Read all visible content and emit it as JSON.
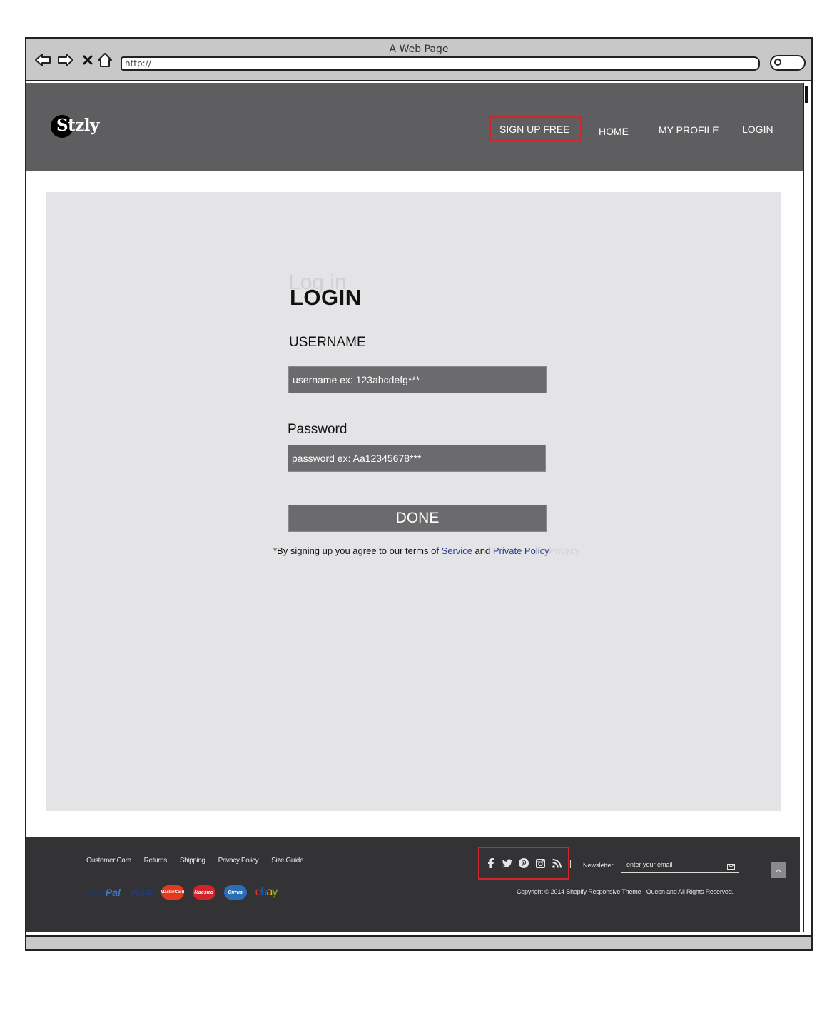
{
  "browser": {
    "title": "A Web Page",
    "url": "http://"
  },
  "header": {
    "logo": "Stzly",
    "nav": {
      "signup": "SIGN UP FREE",
      "home": "HOME",
      "profile": "MY PROFILE",
      "login": "LOGIN"
    },
    "highlight_color": "#d0262b"
  },
  "form": {
    "ghost_title": "Log in",
    "title": "LOGIN",
    "username_label": "USERNAME",
    "username_placeholder": "username ex: 123abcdefg***",
    "password_label": "Password",
    "password_placeholder": "password ex: Aa12345678***",
    "done_label": "DONE",
    "terms_prefix": "*By signing up you agree to our terms of ",
    "service_link": "Service",
    "terms_and": " and ",
    "privacy_link": "Private Policy",
    "terms_faint": "Privacy"
  },
  "footer": {
    "links": [
      "Customer Care",
      "Returns",
      "Shipping",
      "Privacy Policy",
      "Size Guide"
    ],
    "payments": {
      "paypal_a": "Pay",
      "paypal_b": "Pal",
      "visa": "VISA",
      "mastercard": "MasterCard",
      "maestro": "Maestro",
      "cirrus": "Cirrus",
      "ebay": [
        "e",
        "b",
        "a",
        "y"
      ]
    },
    "social_icons": [
      "facebook-icon",
      "twitter-icon",
      "pinterest-icon",
      "instagram-icon",
      "rss-icon"
    ],
    "newsletter_label": "Newsletter",
    "newsletter_placeholder": "enter your email",
    "copyright": "Copyright © 2014 Shopify Responsive Theme - Queen and All Rights Reserved."
  }
}
